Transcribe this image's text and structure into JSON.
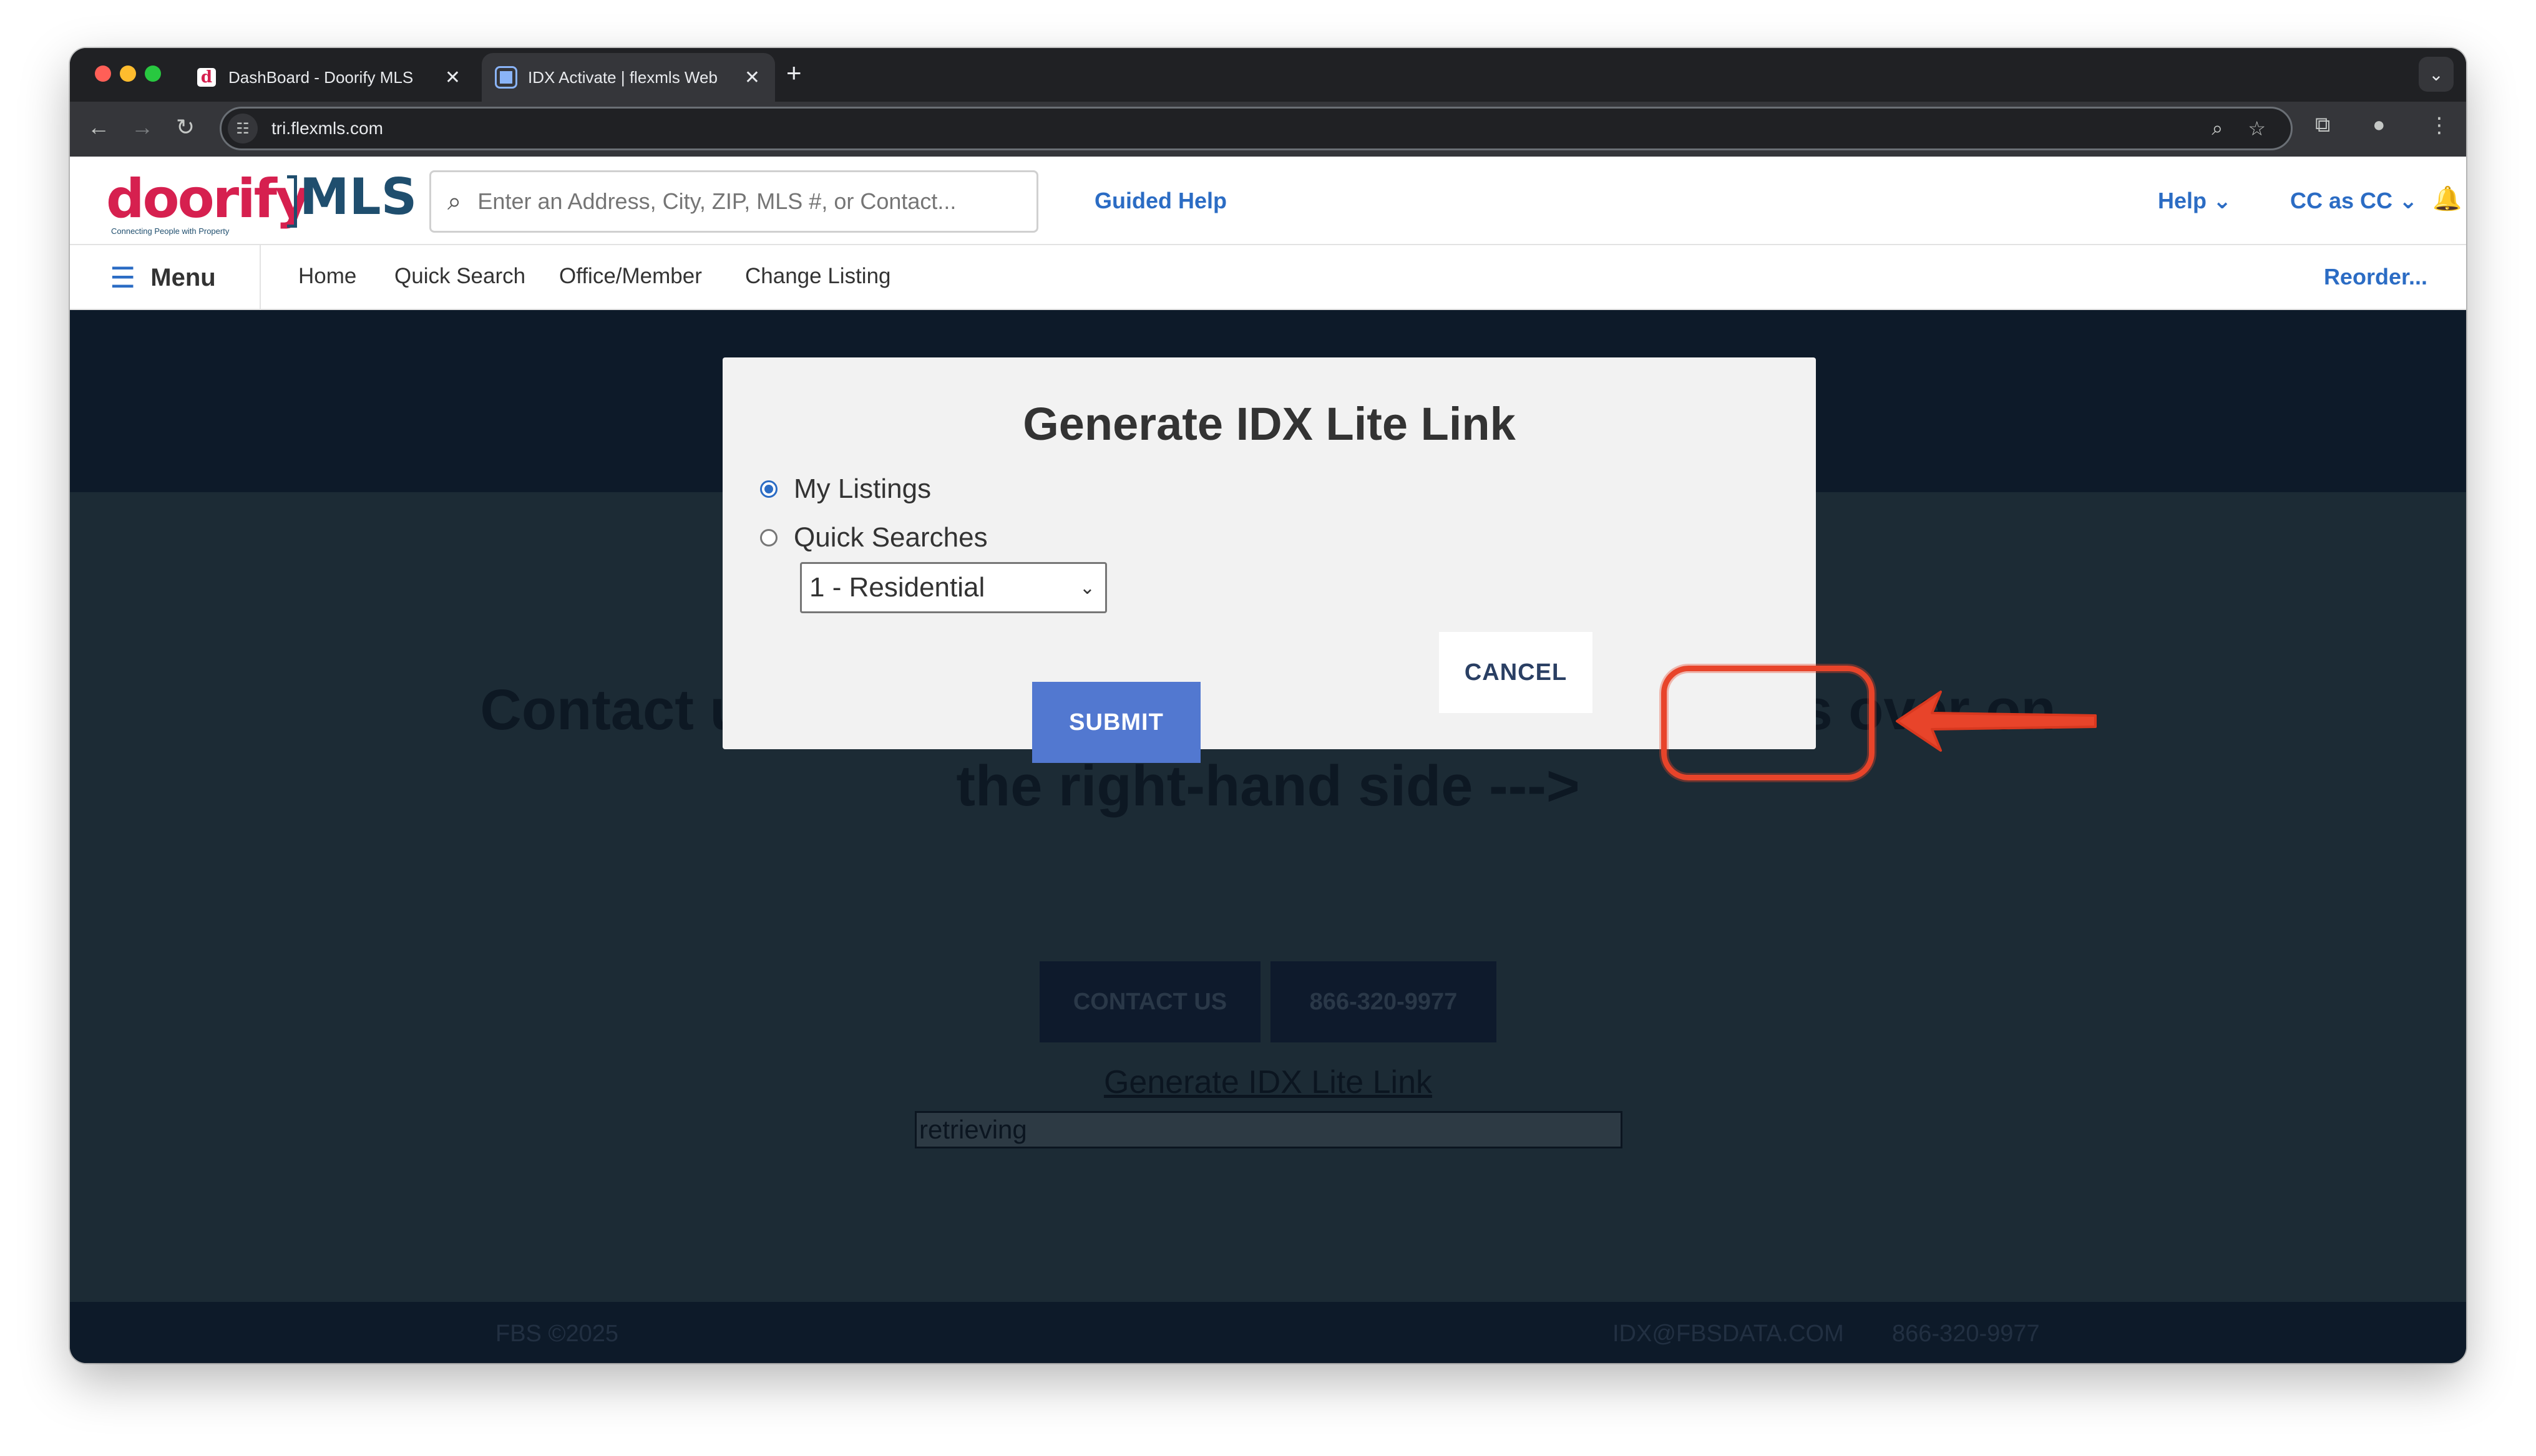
{
  "browser": {
    "tabs": [
      {
        "title": "DashBoard - Doorify MLS",
        "favicon": "doorify-favicon",
        "active": false
      },
      {
        "title": "IDX Activate | flexmls Web",
        "favicon": "globe-favicon",
        "active": true
      }
    ],
    "url": "tri.flexmls.com"
  },
  "header": {
    "logo_word": "doorify",
    "logo_mls": "MLS",
    "logo_tagline": "Connecting People with Property",
    "search_placeholder": "Enter an Address, City, ZIP, MLS #, or Contact...",
    "guided_help": "Guided Help",
    "help": "Help",
    "user": "CC as CC"
  },
  "nav": {
    "menu": "Menu",
    "links": [
      "Home",
      "Quick Search",
      "Office/Member",
      "Change Listing"
    ],
    "reorder": "Reorder..."
  },
  "page": {
    "hero": "Contact us for a free consultation, or chat with us over on the right-hand side --->",
    "contact_button": "CONTACT US",
    "phone_button": "866-320-9977",
    "generate_link": "Generate IDX Lite Link",
    "retrieving": "retrieving"
  },
  "footer": {
    "copyright": "FBS ©2025",
    "email": "IDX@FBSDATA.COM",
    "phone": "866-320-9977"
  },
  "modal": {
    "title": "Generate IDX Lite Link",
    "options": [
      {
        "label": "My Listings",
        "checked": true
      },
      {
        "label": "Quick Searches",
        "checked": false
      }
    ],
    "select_value": "1 - Residential",
    "cancel": "CANCEL",
    "submit": "SUBMIT"
  },
  "annotation": {
    "color": "#e8442a"
  },
  "colors": {
    "brand_red": "#d6204f",
    "brand_navy": "#1f4e6e",
    "link_blue": "#2b6cc4",
    "submit_blue": "#5278d0"
  }
}
